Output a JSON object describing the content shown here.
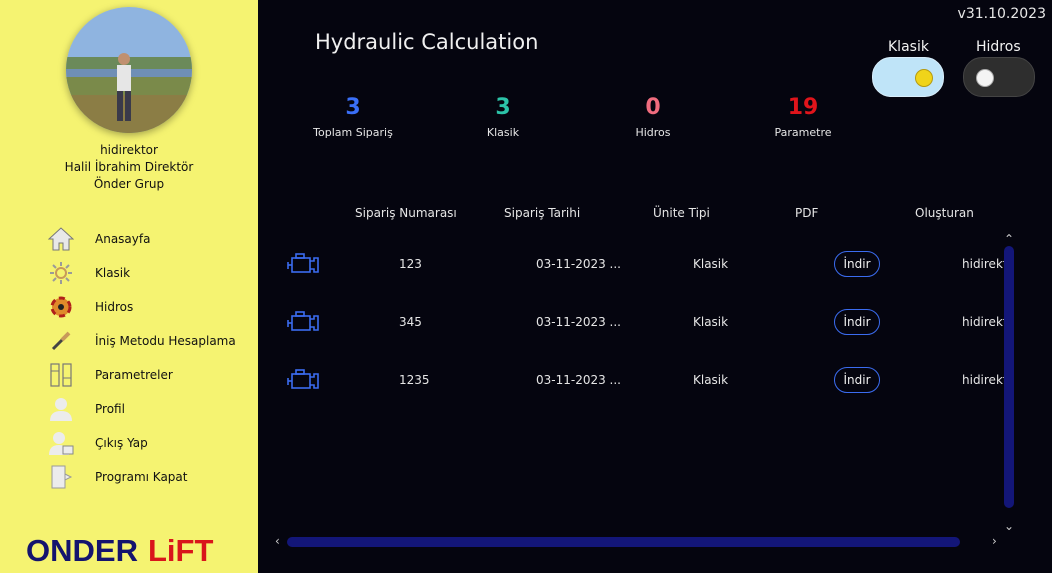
{
  "sidebar": {
    "user": {
      "username": "hidirektor",
      "full_name": "Halil İbrahim Direktör",
      "company": "Önder Grup"
    },
    "items": [
      {
        "label": "Anasayfa",
        "icon": "home-icon"
      },
      {
        "label": "Klasik",
        "icon": "gear-icon"
      },
      {
        "label": "Hidros",
        "icon": "hydraulic-icon"
      },
      {
        "label": "İniş Metodu Hesaplama",
        "icon": "screwdriver-icon"
      },
      {
        "label": "Parametreler",
        "icon": "parameters-icon"
      },
      {
        "label": "Profil",
        "icon": "user-icon"
      },
      {
        "label": "Çıkış Yap",
        "icon": "logout-user-icon"
      },
      {
        "label": "Programı Kapat",
        "icon": "exit-door-icon"
      }
    ],
    "logo": {
      "left": "ONDER",
      "right": "LiFT"
    }
  },
  "header": {
    "version": "v31.10.2023",
    "title": "Hydraulic Calculation"
  },
  "stats": [
    {
      "value": "3",
      "label": "Toplam Sipariş",
      "color": "#3a6ff7"
    },
    {
      "value": "3",
      "label": "Klasik",
      "color": "#2cc3a8"
    },
    {
      "value": "0",
      "label": "Hidros",
      "color": "#f06c7e"
    },
    {
      "value": "19",
      "label": "Parametre",
      "color": "#e0141b"
    }
  ],
  "toggles": {
    "klasik": {
      "label": "Klasik",
      "on": true
    },
    "hidros": {
      "label": "Hidros",
      "on": false
    }
  },
  "table": {
    "columns": [
      "Sipariş Numarası",
      "Sipariş Tarihi",
      "Ünite Tipi",
      "PDF",
      "Oluşturan"
    ],
    "rows": [
      {
        "order_no": "123",
        "date": "03-11-2023 ...",
        "unit_type": "Klasik",
        "pdf": "İndir",
        "creator": "hidirekt"
      },
      {
        "order_no": "345",
        "date": "03-11-2023 ...",
        "unit_type": "Klasik",
        "pdf": "İndir",
        "creator": "hidirekt"
      },
      {
        "order_no": "1235",
        "date": "03-11-2023 ...",
        "unit_type": "Klasik",
        "pdf": "İndir",
        "creator": "hidirekt"
      }
    ]
  }
}
